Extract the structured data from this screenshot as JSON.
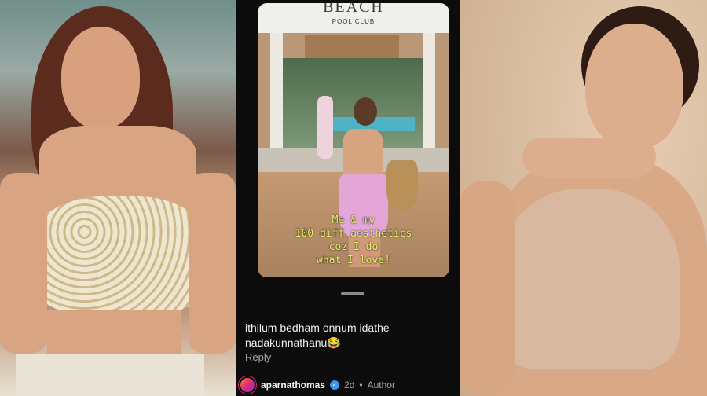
{
  "story": {
    "sign_main": "BEACH",
    "sign_sub": "POOL CLUB",
    "caption_lines": [
      "Me & my",
      "100 diff aesthetics",
      "coz I do",
      "what I love!"
    ]
  },
  "comment": {
    "text": "ithilum bedham onnum idathe nadakunnathanu😂",
    "reply_label": "Reply"
  },
  "author": {
    "username": "aparnathomas",
    "verified_icon": "verified-check-icon",
    "time": "2d",
    "separator": "•",
    "badge": "Author"
  },
  "colors": {
    "caption": "#e8f06a",
    "verified": "#3897f0",
    "background": "#0c0c0c"
  }
}
